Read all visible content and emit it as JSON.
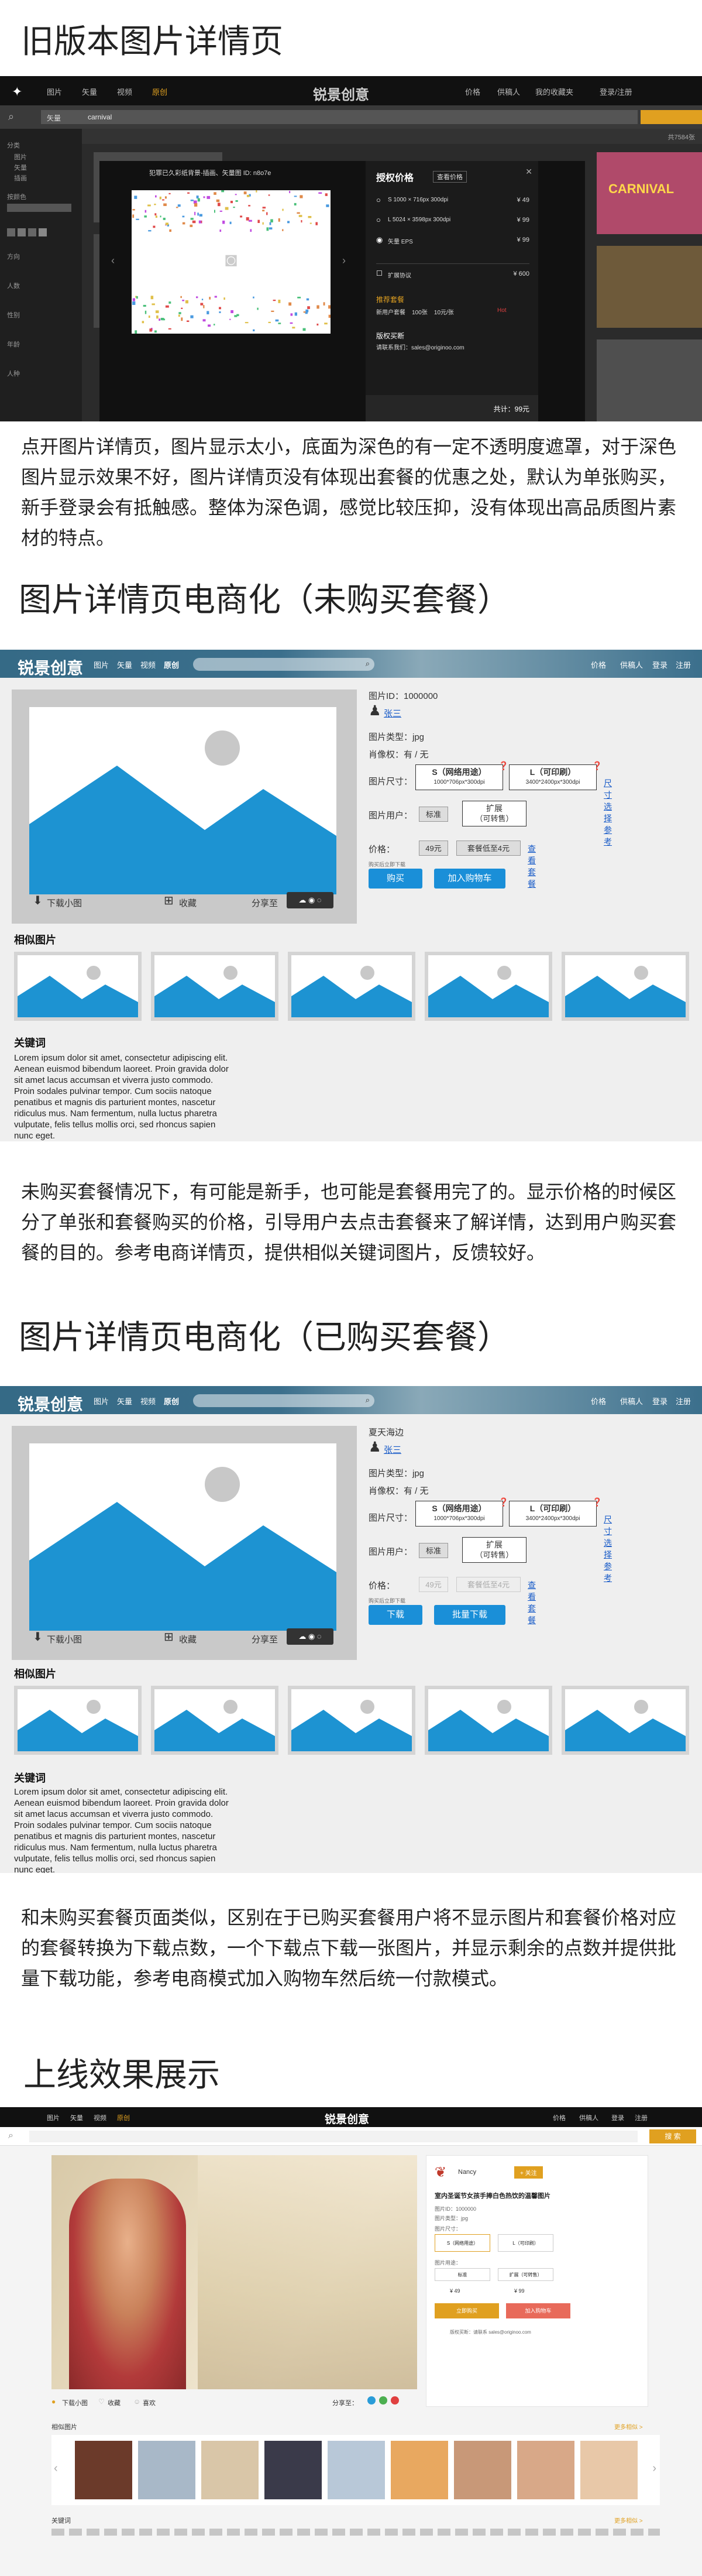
{
  "s1": {
    "title": "旧版本图片详情页",
    "nav": {
      "logo": "锐景创意",
      "links": [
        "图片",
        "矢量",
        "视频",
        "原创"
      ],
      "right": [
        "价格",
        "供稿人",
        "我的收藏夹",
        "登录/注册"
      ]
    },
    "search": {
      "cat": "矢量",
      "value": "carnival",
      "count": "共7584张"
    },
    "filters": [
      "分类",
      "图片",
      "矢量",
      "插画",
      "按颜色",
      "方向",
      "人数",
      "性别",
      "年龄",
      "人种"
    ],
    "modal_caption": "犯罪已久彩纸背景-插画、矢量图 ID: n8o7e",
    "price": {
      "title": "授权价格",
      "tab": "查看价格",
      "items": [
        {
          "label": "S 1000 × 716px 300dpi",
          "price": "¥ 49"
        },
        {
          "label": "L 5024 × 3598px 300dpi",
          "price": "¥ 99"
        },
        {
          "label": "矢量 EPS",
          "price": "¥ 99"
        }
      ],
      "ext_label": "扩展协议",
      "ext_price": "¥ 600",
      "pkg_title": "推荐套餐",
      "pkg_row": "新用户套餐    100张    10元/张",
      "pkg_badge": "Hot",
      "auth_title": "版权买断",
      "auth_contact": "请联系我们：sales@originoo.com",
      "total": "共计：99元"
    },
    "banner": "CARNIVAL"
  },
  "p1": "点开图片详情页，图片显示太小，底面为深色的有一定不透明度遮罩，对于深色图片显示效果不好，图片详情页没有体现出套餐的优惠之处，默认为单张购买，新手登录会有抵触感。整体为深色调，感觉比较压抑，没有体现出高品质图片素材的特点。",
  "s2": {
    "title": "图片详情页电商化（未购买套餐）",
    "nav": {
      "logo": "锐景创意",
      "links": [
        "图片",
        "矢量",
        "视频",
        "原创"
      ],
      "right": [
        "价格",
        "供稿人",
        "登录",
        "注册"
      ]
    },
    "bar": {
      "download": "下载小图",
      "fav": "收藏",
      "share": "分享至"
    },
    "info": {
      "id": "图片ID：1000000",
      "author": "张三",
      "type": "图片类型：jpg",
      "portrait": "肖像权：有 / 无",
      "size_label": "图片尺寸：",
      "opt_s": "S（网络用途）",
      "opt_s_sub": "1000*706px*300dpi",
      "opt_l": "L（可印刷）",
      "opt_l_sub": "3400*2400px*300dpi",
      "size_link": "尺寸选择参考",
      "use_label": "图片用户：",
      "use_std": "标准",
      "use_ext": "扩展",
      "use_ext_sub": "（可转售）",
      "price_label": "价格：",
      "price_val": "49元",
      "price_pkg": "套餐低至4元",
      "pkg_link": "查看套餐",
      "note": "购买后立即下载",
      "buy": "购买",
      "cart": "加入购物车"
    },
    "similar": "相似图片",
    "keywords": "关键词",
    "lorem": "Lorem ipsum dolor sit amet, consectetur adipiscing elit. Aenean euismod bibendum laoreet. Proin gravida dolor sit amet lacus accumsan et viverra justo commodo. Proin sodales pulvinar tempor. Cum sociis natoque penatibus et magnis dis parturient montes, nascetur ridiculus mus. Nam fermentum, nulla luctus pharetra vulputate, felis tellus mollis orci, sed rhoncus sapien nunc eget."
  },
  "p2": "未购买套餐情况下，有可能是新手，也可能是套餐用完了的。显示价格的时候区分了单张和套餐购买的价格，引导用户去点击套餐来了解详情，达到用户购买套餐的目的。参考电商详情页，提供相似关键词图片，反馈较好。",
  "s3": {
    "title": "图片详情页电商化（已购买套餐）",
    "info": {
      "name": "夏天海边",
      "author": "张三",
      "type": "图片类型：jpg",
      "portrait": "肖像权：有 / 无",
      "price_val": "49元",
      "price_pkg": "套餐低至4元",
      "download": "下载",
      "batch": "批量下载",
      "note": "购买后立即下载"
    }
  },
  "p3": "和未购买套餐页面类似，区别在于已购买套餐用户将不显示图片和套餐价格对应的套餐转换为下载点数，一个下载点下载一张图片，并显示剩余的点数并提供批量下载功能，参考电商模式加入购物车然后统一付款模式。",
  "s4": {
    "title": "上线效果展示",
    "nav": {
      "logo": "锐景创意",
      "links": [
        "图片",
        "矢量",
        "视频",
        "原创"
      ],
      "right": [
        "价格",
        "供稿人",
        "登录",
        "注册"
      ]
    },
    "search_btn": "搜 索",
    "user": "Nancy",
    "follow": "+ 关注",
    "pic_title": "室内圣诞节女孩手捧白色热饮的温馨图片",
    "id": "图片ID：1000000",
    "type": "图片类型：jpg",
    "size": "图片尺寸：",
    "opt_s": "S（网络用途）",
    "opt_l": "L（可印刷）",
    "use": "图片用途：",
    "std": "标准",
    "ext": "扩展（可转售）",
    "price_a": "¥ 49",
    "price_b": "¥ 99",
    "buy": "立即购买",
    "cart": "加入购物车",
    "contact": "版权买断：请联系 sales@originoo.com",
    "bar": [
      "下载小图",
      "收藏",
      "喜欢",
      "分享至："
    ],
    "similar": "相似图片",
    "more": "更多相似 >",
    "keywords": "关键词"
  }
}
